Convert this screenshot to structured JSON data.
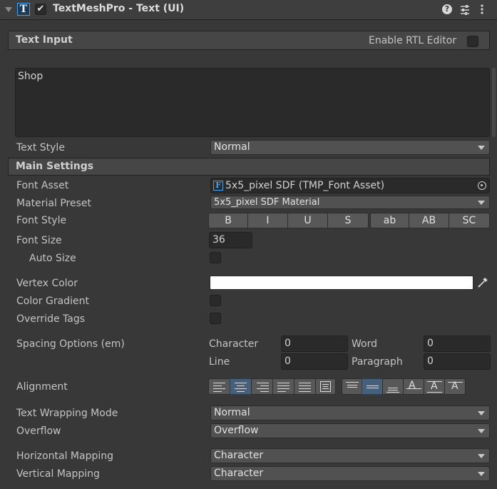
{
  "component": {
    "title": "TextMeshPro - Text (UI)",
    "help_icon": "help-icon",
    "preset_icon": "preset-icon",
    "menu_icon": "kebab-menu-icon"
  },
  "text_input": {
    "section_title": "Text Input",
    "rtl_label": "Enable RTL Editor",
    "text_value": "Shop",
    "style_label": "Text Style",
    "style_value": "Normal"
  },
  "main_settings": {
    "section_title": "Main Settings",
    "font_asset_label": "Font Asset",
    "font_asset_value": "5x5_pixel SDF (TMP_Font Asset)",
    "material_preset_label": "Material Preset",
    "material_preset_value": "5x5_pixel SDF Material",
    "font_style_label": "Font Style",
    "font_style_buttons": [
      "B",
      "I",
      "U",
      "S",
      "ab",
      "AB",
      "SC"
    ],
    "font_size_label": "Font Size",
    "font_size_value": "36",
    "auto_size_label": "Auto Size",
    "vertex_color_label": "Vertex Color",
    "vertex_color": "#ffffff",
    "color_gradient_label": "Color Gradient",
    "override_tags_label": "Override Tags",
    "spacing_label": "Spacing Options (em)",
    "spacing": {
      "character_label": "Character",
      "character_value": "0",
      "word_label": "Word",
      "word_value": "0",
      "line_label": "Line",
      "line_value": "0",
      "paragraph_label": "Paragraph",
      "paragraph_value": "0"
    },
    "alignment_label": "Alignment",
    "wrapping_label": "Text Wrapping Mode",
    "wrapping_value": "Normal",
    "overflow_label": "Overflow",
    "overflow_value": "Overflow",
    "h_mapping_label": "Horizontal Mapping",
    "h_mapping_value": "Character",
    "v_mapping_label": "Vertical Mapping",
    "v_mapping_value": "Character"
  },
  "colors": {
    "selected_button": "#46607c",
    "accent_icon": "#4aa3e8"
  }
}
